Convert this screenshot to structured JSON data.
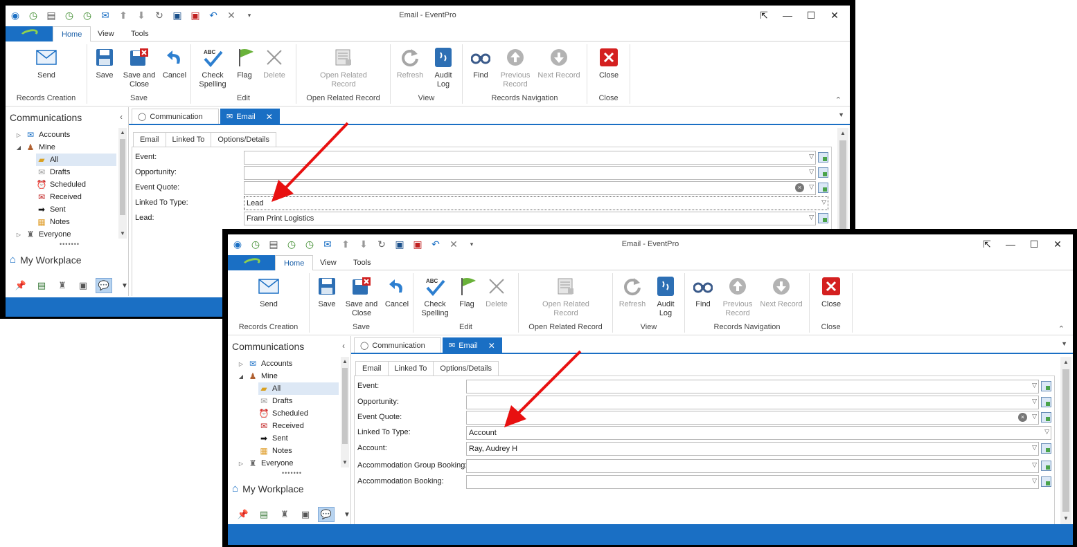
{
  "colors": {
    "accent": "#1a6fc4",
    "arrow": "#e81010"
  },
  "window": {
    "title": "Email - EventPro",
    "ribbon_tabs": [
      "Home",
      "View",
      "Tools"
    ],
    "ribbon": {
      "send": "Send",
      "save": "Save",
      "save_close_1": "Save and",
      "save_close_2": "Close",
      "cancel": "Cancel",
      "check_1": "Check",
      "check_2": "Spelling",
      "flag": "Flag",
      "delete": "Delete",
      "open_related_1": "Open Related",
      "open_related_2": "Record",
      "refresh": "Refresh",
      "audit_1": "Audit",
      "audit_2": "Log",
      "find": "Find",
      "previous_1": "Previous",
      "previous_2": "Record",
      "next": "Next Record",
      "close": "Close",
      "groups": {
        "records_creation": "Records Creation",
        "save": "Save",
        "edit": "Edit",
        "open_related": "Open Related Record",
        "view": "View",
        "navigation": "Records Navigation",
        "close": "Close"
      }
    },
    "sidebar": {
      "title": "Communications",
      "tree": {
        "accounts": "Accounts",
        "mine": "Mine",
        "all": "All",
        "drafts": "Drafts",
        "scheduled": "Scheduled",
        "received": "Received",
        "sent": "Sent",
        "notes": "Notes",
        "everyone": "Everyone"
      },
      "workplace": "My Workplace"
    },
    "doc_tabs": {
      "communication": "Communication",
      "email": "Email"
    },
    "sub_tabs": {
      "email": "Email",
      "linked_to": "Linked To",
      "options": "Options/Details"
    }
  },
  "form1": {
    "event_label": "Event:",
    "opportunity_label": "Opportunity:",
    "quote_label": "Event Quote:",
    "type_label": "Linked To Type:",
    "type_value": "Lead",
    "lead_label": "Lead:",
    "lead_value": "Fram Print Logistics"
  },
  "form2": {
    "event_label": "Event:",
    "opportunity_label": "Opportunity:",
    "quote_label": "Event Quote:",
    "type_label": "Linked To Type:",
    "type_value": "Account",
    "account_label": "Account:",
    "account_value": "Ray, Audrey H",
    "group_booking_label": "Accommodation Group Booking:",
    "booking_label": "Accommodation Booking:"
  }
}
